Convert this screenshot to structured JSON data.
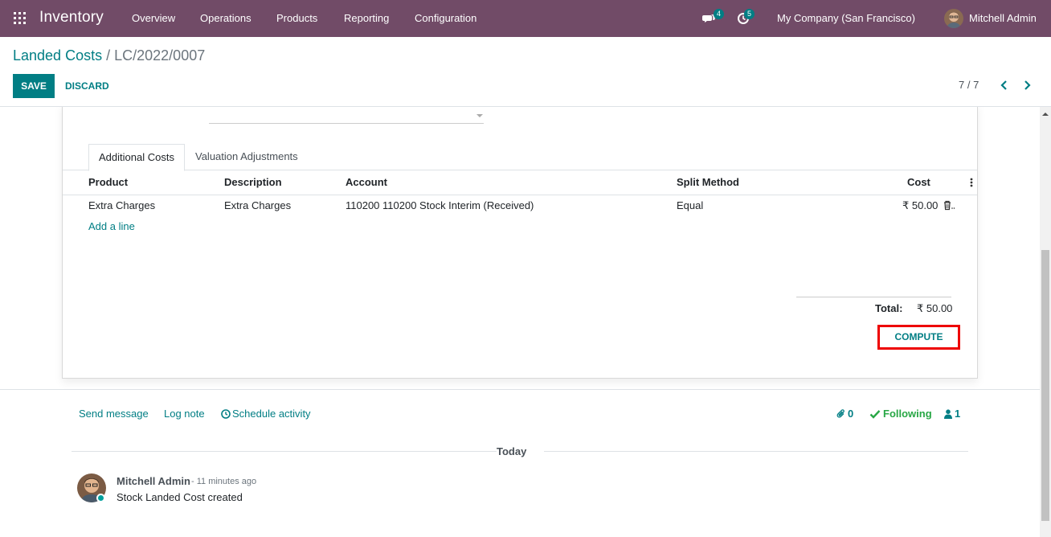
{
  "topbar": {
    "app_name": "Inventory",
    "menu": [
      "Overview",
      "Operations",
      "Products",
      "Reporting",
      "Configuration"
    ],
    "messages_count": "4",
    "activities_count": "5",
    "company": "My Company (San Francisco)",
    "user": "Mitchell Admin",
    "brand_color": "#714b67",
    "accent_color": "#017e84"
  },
  "control": {
    "breadcrumb_parent": "Landed Costs",
    "breadcrumb_sep": "/",
    "breadcrumb_current": "LC/2022/0007",
    "save_label": "SAVE",
    "discard_label": "DISCARD",
    "pager": "7 / 7"
  },
  "form": {
    "tabs": [
      "Additional Costs",
      "Valuation Adjustments"
    ],
    "columns": [
      "Product",
      "Description",
      "Account",
      "Split Method",
      "Cost"
    ],
    "rows": [
      {
        "product": "Extra Charges",
        "description": "Extra Charges",
        "account": "110200 110200 Stock Interim (Received)",
        "split": "Equal",
        "cost": "₹ 50.00"
      }
    ],
    "add_line": "Add a line",
    "total_label": "Total:",
    "total_value": "₹ 50.00",
    "compute_label": "COMPUTE"
  },
  "chatter": {
    "send_message": "Send message",
    "log_note": "Log note",
    "schedule_activity": "Schedule activity",
    "attachments": "0",
    "following": "Following",
    "followers": "1",
    "date_separator": "Today",
    "author": "Mitchell Admin",
    "time": "- 11 minutes ago",
    "body": "Stock Landed Cost created"
  }
}
